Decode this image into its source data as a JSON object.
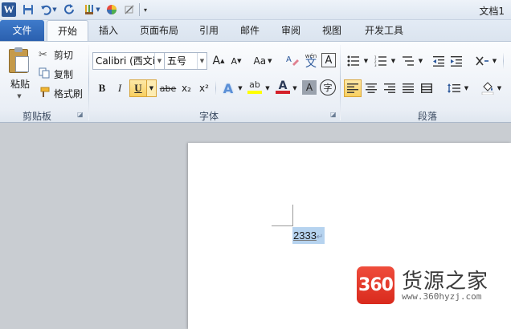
{
  "window": {
    "title": "文档1",
    "app_icon_letter": "W"
  },
  "ribbon_tabs": [
    {
      "label": "文件",
      "active": false
    },
    {
      "label": "开始",
      "active": true
    },
    {
      "label": "插入",
      "active": false
    },
    {
      "label": "页面布局",
      "active": false
    },
    {
      "label": "引用",
      "active": false
    },
    {
      "label": "邮件",
      "active": false
    },
    {
      "label": "审阅",
      "active": false
    },
    {
      "label": "视图",
      "active": false
    },
    {
      "label": "开发工具",
      "active": false
    }
  ],
  "clipboard": {
    "group_label": "剪贴板",
    "paste_label": "粘贴",
    "cut_label": "剪切",
    "copy_label": "复制",
    "format_painter_label": "格式刷"
  },
  "font": {
    "group_label": "字体",
    "font_name": "Calibri (西文i",
    "font_size": "五号",
    "bold": "B",
    "italic": "I",
    "underline": "U",
    "strike": "abe",
    "subscript": "x₂",
    "superscript": "x²",
    "change_case": "Aa",
    "grow": "A",
    "shrink": "A",
    "phonetic": "wén",
    "phonetic_char": "文",
    "border_char": "A",
    "shade_char": "A",
    "enclose_char": "字",
    "font_color_char": "A",
    "highlight_char": "ab",
    "effects_char": "A"
  },
  "paragraph": {
    "group_label": "段落"
  },
  "document": {
    "selected_text": "2333"
  },
  "watermark": {
    "logo_text": "360",
    "site_name": "货源之家",
    "url": "www.360hyzj.com"
  },
  "colors": {
    "file_tab": "#2a5fae",
    "selection": "#b6d3ef",
    "highlight": "#ffff00",
    "font_color": "#d4202a",
    "watermark_red": "#d92a1d"
  }
}
